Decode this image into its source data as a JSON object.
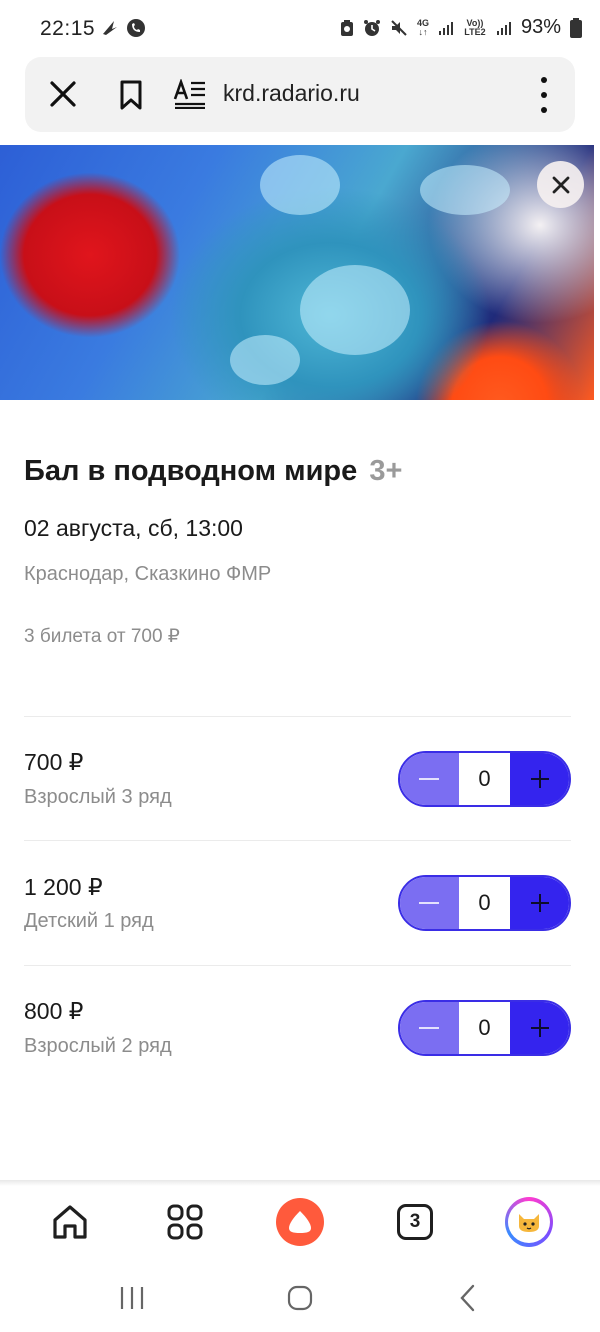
{
  "status_bar": {
    "time": "22:15",
    "battery": "93%",
    "network_4g": "4G",
    "volte": "Vo)) LTE2"
  },
  "url_bar": {
    "url": "krd.radario.ru",
    "icons": [
      "close-icon",
      "bookmark-icon",
      "reader-mode-icon",
      "more-vert-icon"
    ]
  },
  "event": {
    "title": "Бал в подводном мире",
    "age": "3+",
    "date": "02 августа, сб, 13:00",
    "place": "Краснодар, Сказкино ФМР",
    "tickets_summary": "3 билета от 700 ₽"
  },
  "tickets": [
    {
      "price": "700 ₽",
      "description": "Взрослый 3 ряд",
      "quantity": "0"
    },
    {
      "price": "1 200 ₽",
      "description": "Детский 1 ряд",
      "quantity": "0"
    },
    {
      "price": "800 ₽",
      "description": "Взрослый 2 ряд",
      "quantity": "0"
    }
  ],
  "bottom_bar": {
    "tabs_count": "3",
    "icons": [
      "home-icon",
      "services-grid-icon",
      "alice-icon",
      "tabs-icon",
      "avatar-icon"
    ]
  },
  "colors": {
    "stepper_border": "#3a2de6",
    "stepper_minus": "#7b6ef2",
    "stepper_plus": "#3424ee",
    "alice": "#ff5a3c"
  }
}
